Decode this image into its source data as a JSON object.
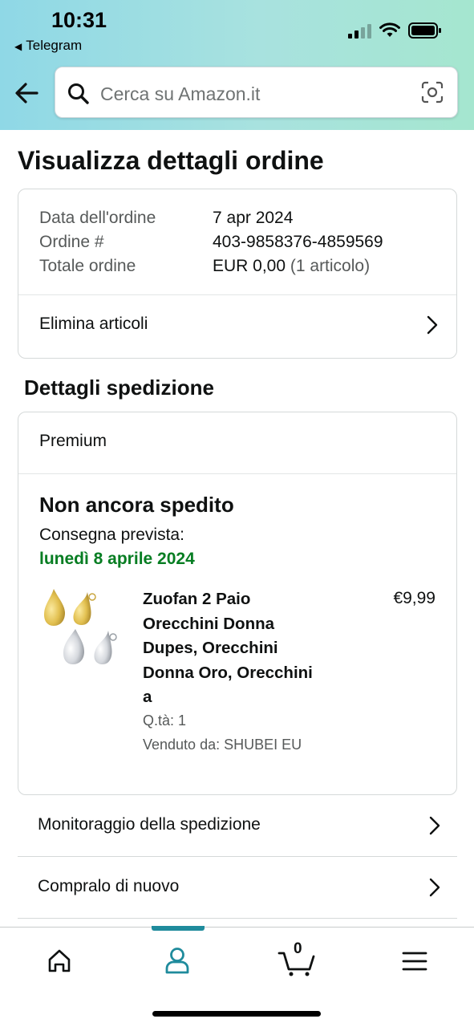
{
  "status_bar": {
    "time": "10:31",
    "back_app": "Telegram"
  },
  "search": {
    "placeholder": "Cerca su Amazon.it",
    "icons": [
      "back-arrow-icon",
      "search-icon",
      "camera-scan-icon"
    ]
  },
  "page_title": "Visualizza dettagli ordine",
  "order": {
    "rows": [
      {
        "label": "Data dell'ordine",
        "value": "7 apr 2024"
      },
      {
        "label": "Ordine #",
        "value": "403-9858376-4859569"
      },
      {
        "label": "Totale ordine",
        "value": "EUR 0,00",
        "value_suffix": " (1 articolo)"
      }
    ],
    "delete_items": "Elimina articoli"
  },
  "shipment": {
    "section_title": "Dettagli spedizione",
    "tier": "Premium",
    "status": "Non ancora spedito",
    "delivery_label": "Consegna prevista:",
    "delivery_date": "lunedì 8 aprile 2024",
    "delivery_color": "#067d22",
    "product": {
      "title": "Zuofan 2 Paio\nOrecchini Donna\nDupes, Orecchini\nDonna Oro, Orecchini\na",
      "price": "€9,99",
      "qty": "Q.tà: 1",
      "seller": "Venduto da: SHUBEI EU"
    }
  },
  "actions": [
    {
      "label": "Monitoraggio della spedizione"
    },
    {
      "label": "Compralo di nuovo"
    }
  ],
  "tab_bar": {
    "cart_count": "0",
    "active_tab": "account",
    "accent": "#1f8b9c",
    "tabs": [
      "home-icon",
      "account-icon",
      "cart-icon",
      "menu-icon"
    ]
  }
}
